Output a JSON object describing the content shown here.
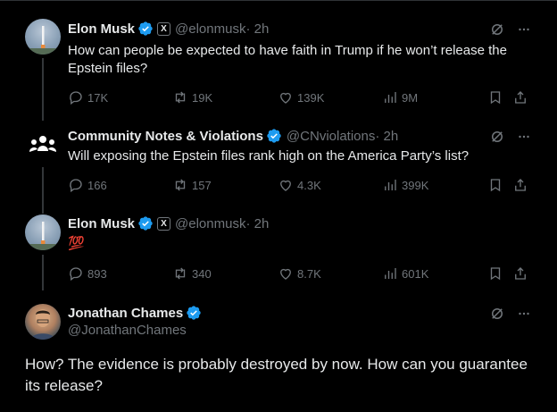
{
  "thread": [
    {
      "name": "Elon Musk",
      "handle": "@elonmusk",
      "time": "· 2h",
      "text": "How can people be expected to have faith in Trump if he won’t release the Epstein files?",
      "replies": "17K",
      "reposts": "19K",
      "likes": "139K",
      "views": "9M",
      "affiliate_badge": "X"
    },
    {
      "name": "Community Notes & Violations",
      "handle": "@CNviolations",
      "time": "· 2h",
      "text": "Will exposing the Epstein files rank high on the America Party’s list?",
      "replies": "166",
      "reposts": "157",
      "likes": "4.3K",
      "views": "399K"
    },
    {
      "name": "Elon Musk",
      "handle": "@elonmusk",
      "time": "· 2h",
      "text": "💯",
      "replies": "893",
      "reposts": "340",
      "likes": "8.7K",
      "views": "601K",
      "affiliate_badge": "X"
    }
  ],
  "main_tweet": {
    "name": "Jonathan Chames",
    "handle": "@JonathanChames",
    "text": "How? The evidence is probably destroyed by now. How can you guarantee its release?"
  },
  "colors": {
    "background": "#000000",
    "text": "#e7e9ea",
    "muted": "#71767b",
    "verified": "#1d9bf0",
    "grok": "#71767b"
  },
  "icons": [
    "reply-icon",
    "repost-icon",
    "like-icon",
    "views-icon",
    "bookmark-icon",
    "share-icon",
    "grok-icon",
    "more-icon",
    "verified-icon"
  ]
}
